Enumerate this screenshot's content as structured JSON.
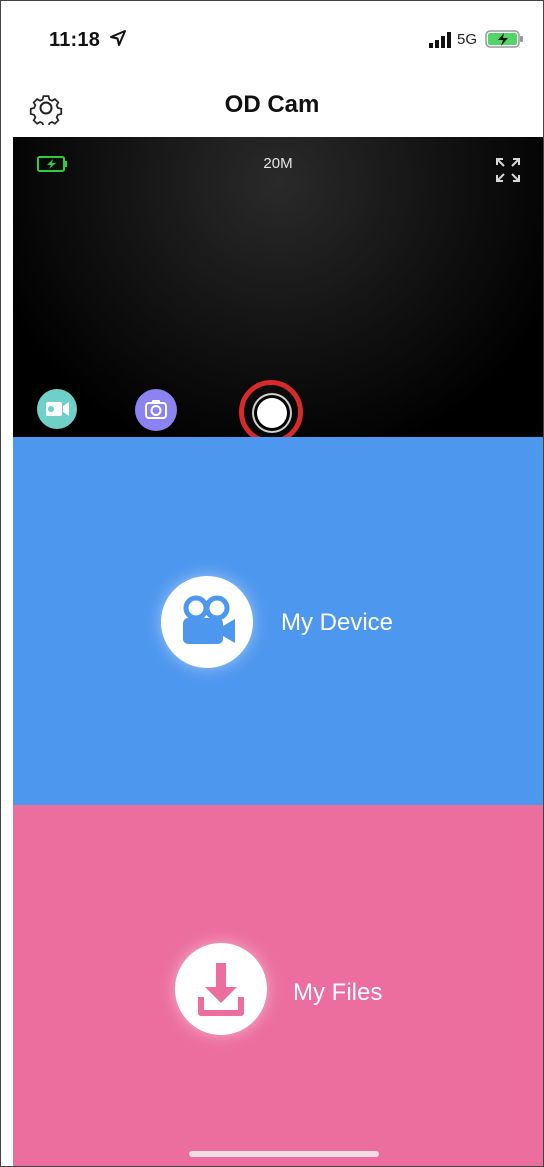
{
  "status_bar": {
    "time": "11:18",
    "network": "5G",
    "icons": [
      "location-arrow-icon",
      "signal-bars-icon",
      "battery-charging-icon"
    ]
  },
  "header": {
    "title": "OD Cam",
    "settings_icon": "gear-icon"
  },
  "preview": {
    "resolution": "20M",
    "icons": [
      "camera-battery-icon",
      "fullscreen-icon",
      "video-camera-icon",
      "photo-camera-icon",
      "shutter-button"
    ]
  },
  "panels": {
    "device": {
      "label": "My Device",
      "icon": "movie-camera-icon",
      "color": "#4e97ef"
    },
    "files": {
      "label": "My Files",
      "icon": "download-icon",
      "color": "#ec6e9e"
    }
  },
  "colors": {
    "video_button": "#6ed0c6",
    "photo_button": "#8b84f0",
    "highlight_ring": "#d72b2b",
    "battery_green": "#2ecc40"
  }
}
